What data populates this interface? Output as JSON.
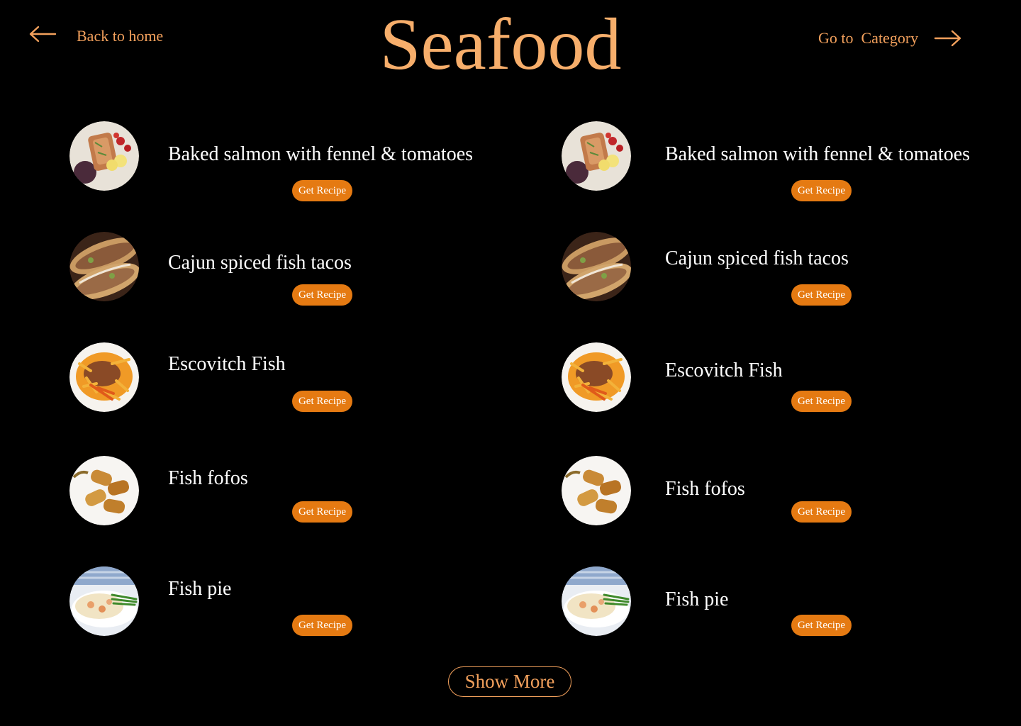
{
  "nav": {
    "back_label": "Back to home",
    "category_label": "Go to  Category"
  },
  "page": {
    "title": "Seafood"
  },
  "recipes": {
    "left": [
      {
        "name": "Baked salmon with fennel & tomatoes",
        "button": "Get Recipe",
        "image": "salmon-plate"
      },
      {
        "name": "Cajun spiced fish tacos",
        "button": "Get Recipe",
        "image": "fish-tacos"
      },
      {
        "name": "Escovitch Fish",
        "button": "Get Recipe",
        "image": "escovitch-fish"
      },
      {
        "name": "Fish fofos",
        "button": "Get Recipe",
        "image": "fish-fofos"
      },
      {
        "name": "Fish pie",
        "button": "Get Recipe",
        "image": "fish-pie"
      }
    ],
    "right": [
      {
        "name": "Baked salmon with fennel & tomatoes",
        "button": "Get Recipe",
        "image": "salmon-plate"
      },
      {
        "name": "Cajun spiced fish tacos",
        "button": "Get Recipe",
        "image": "fish-tacos"
      },
      {
        "name": "Escovitch Fish",
        "button": "Get Recipe",
        "image": "escovitch-fish"
      },
      {
        "name": "Fish fofos",
        "button": "Get Recipe",
        "image": "fish-fofos"
      },
      {
        "name": "Fish pie",
        "button": "Get Recipe",
        "image": "fish-pie"
      }
    ]
  },
  "footer": {
    "show_more_label": "Show More"
  },
  "colors": {
    "background": "#000000",
    "accent": "#f2a05c",
    "title": "#f7ae6b",
    "button": "#e57a12",
    "text": "#ffffff"
  }
}
